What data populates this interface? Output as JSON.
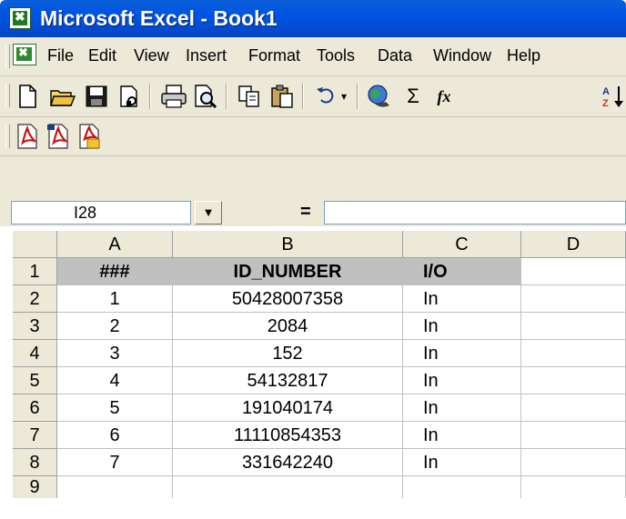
{
  "window": {
    "title": "Microsoft Excel - Book1"
  },
  "menu": {
    "items": [
      "File",
      "Edit",
      "View",
      "Insert",
      "Format",
      "Tools",
      "Data",
      "Window",
      "Help"
    ]
  },
  "toolbar": {
    "standard_icons": [
      "new-document-icon",
      "open-folder-icon",
      "save-icon",
      "permission-icon",
      "print-icon",
      "print-preview-icon",
      "copy-icon",
      "paste-icon",
      "undo-icon",
      "undo-dropdown-icon",
      "web-globe-icon",
      "autosum-icon",
      "function-icon",
      "sort-ascending-icon"
    ],
    "autosum_glyph": "Σ",
    "function_glyph": "fx",
    "pdf_icons": [
      "convert-to-pdf-icon",
      "convert-to-pdf-attach-icon",
      "convert-to-pdf-review-icon"
    ]
  },
  "formula_bar": {
    "name_box": "I28",
    "equals": "=",
    "formula": ""
  },
  "sheet": {
    "columns": [
      "A",
      "B",
      "C",
      "D"
    ],
    "row_numbers": [
      "1",
      "2",
      "3",
      "4",
      "5",
      "6",
      "7",
      "8",
      "9"
    ],
    "header": [
      "###",
      "ID_NUMBER",
      "I/O",
      ""
    ],
    "rows": [
      [
        "1",
        "50428007358",
        "In",
        ""
      ],
      [
        "2",
        "2084",
        "In",
        ""
      ],
      [
        "3",
        "152",
        "In",
        ""
      ],
      [
        "4",
        "54132817",
        "In",
        ""
      ],
      [
        "5",
        "191040174",
        "In",
        ""
      ],
      [
        "6",
        "11110854353",
        "In",
        ""
      ],
      [
        "7",
        "331642240",
        "In",
        ""
      ]
    ]
  }
}
